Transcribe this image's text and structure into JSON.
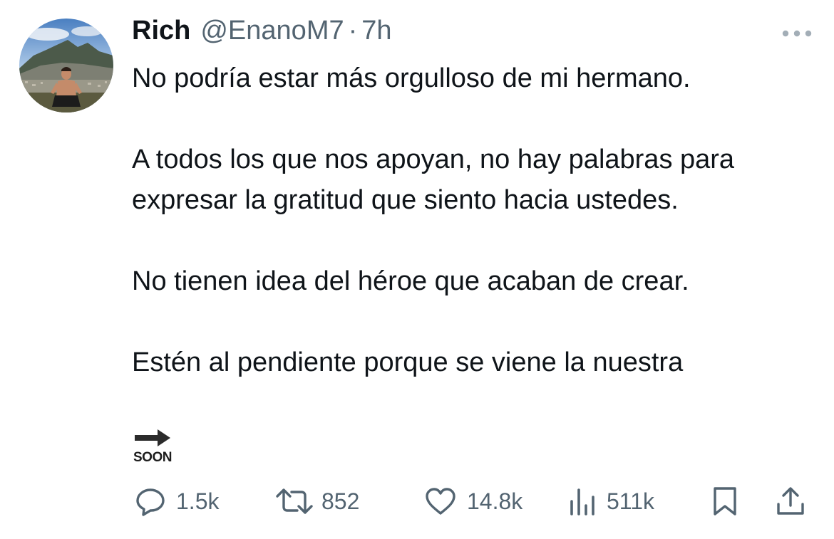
{
  "author": {
    "name": "Rich",
    "handle": "@EnanoM7",
    "separator": "·",
    "time": "7h"
  },
  "tweet": {
    "paragraphs": [
      "No podría estar más orgulloso de mi hermano.",
      "A todos los que nos apoyan, no hay palabras para expresar la gratitud que siento hacia ustedes.",
      "No tienen idea del héroe que acaban de crear.",
      "Estén al pendiente porque se viene la nuestra"
    ],
    "soon_label": "SOON"
  },
  "actions": {
    "replies": "1.5k",
    "retweets": "852",
    "likes": "14.8k",
    "views": "511k"
  },
  "icons": {
    "avatar": "avatar-photo",
    "more": "more-horizontal-icon",
    "soon": "soon-arrow-emoji",
    "reply": "reply-icon",
    "retweet": "retweet-icon",
    "like": "heart-icon",
    "views": "views-chart-icon",
    "bookmark": "bookmark-icon",
    "share": "share-icon"
  },
  "colors": {
    "text": "#0f1419",
    "secondary": "#536471"
  }
}
